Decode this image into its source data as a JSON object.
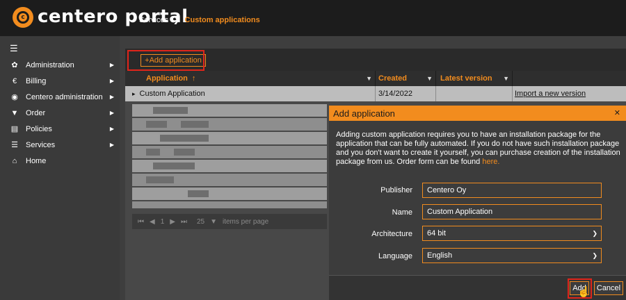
{
  "header": {
    "logo_text": "centero portal",
    "breadcrumb": [
      "Services",
      "Custom applications"
    ],
    "breadcrumb_sep": "❯"
  },
  "sidebar": {
    "menu_icon": "☰",
    "items": [
      {
        "label": "Administration",
        "icon": "gear-icon",
        "glyph": "✿",
        "has_submenu": true
      },
      {
        "label": "Billing",
        "icon": "euro-icon",
        "glyph": "€",
        "has_submenu": true
      },
      {
        "label": "Centero administration",
        "icon": "centero-icon",
        "glyph": "◉",
        "has_submenu": true
      },
      {
        "label": "Order",
        "icon": "cart-icon",
        "glyph": "▼",
        "has_submenu": true
      },
      {
        "label": "Policies",
        "icon": "policy-icon",
        "glyph": "▤",
        "has_submenu": true
      },
      {
        "label": "Services",
        "icon": "services-icon",
        "glyph": "☰",
        "has_submenu": true
      },
      {
        "label": "Home",
        "icon": "home-icon",
        "glyph": "⌂",
        "has_submenu": false
      }
    ]
  },
  "toolbar": {
    "add_application_label": "+Add application"
  },
  "grid": {
    "columns": [
      "Application",
      "Created",
      "Latest version"
    ],
    "sort_indicator": "↑",
    "row": {
      "expander": "▸",
      "application": "Custom Application",
      "created": "3/14/2022",
      "latest_version": "",
      "action": "Import a new version"
    },
    "pager": {
      "first": "⏮",
      "prev": "◀",
      "page": "1",
      "next": "▶",
      "last": "⏭",
      "page_size": "25",
      "items_per_page": "items per page"
    }
  },
  "dialog": {
    "title": "Add application",
    "close": "✕",
    "body_text": "Adding custom application requires you to have an installation package for the application that can be fully automated. If you do not have such installation package and you don't want to create it yourself, you can purchase creation of the installation package from us. Order form can be found ",
    "here_link": "here.",
    "fields": {
      "publisher_label": "Publisher",
      "publisher_value": "Centero Oy",
      "name_label": "Name",
      "name_value": "Custom Application",
      "architecture_label": "Architecture",
      "architecture_value": "64 bit",
      "language_label": "Language",
      "language_value": "English"
    },
    "add_button": "Add",
    "cancel_button": "Cancel"
  },
  "colors": {
    "accent": "#f28c1e",
    "highlight": "#e0251b"
  }
}
